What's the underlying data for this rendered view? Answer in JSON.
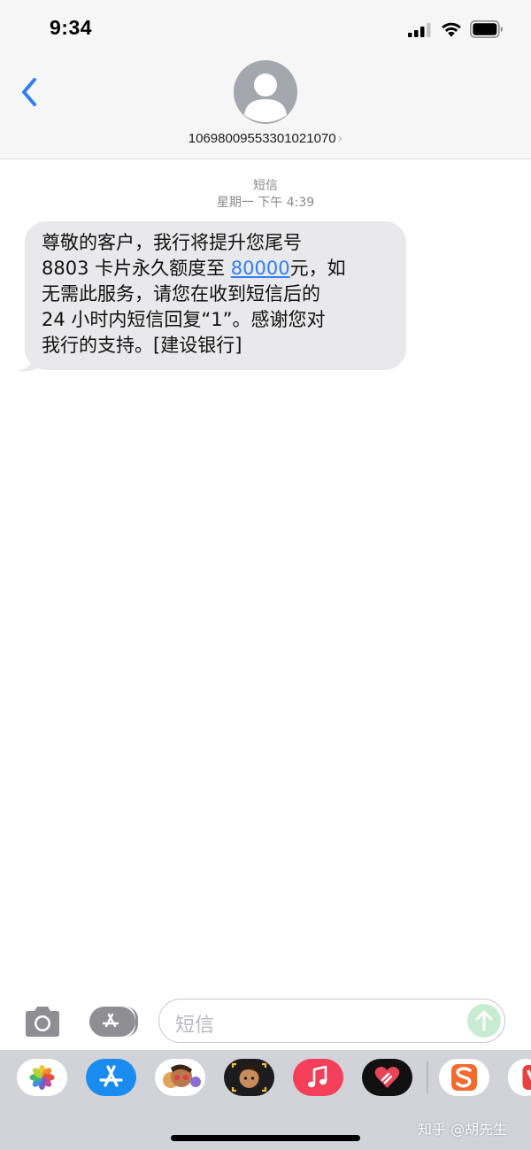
{
  "status_bar": {
    "time": "9:34"
  },
  "header": {
    "contact_number": "10698009553301021070",
    "contact_chevron": "›"
  },
  "conversation": {
    "service_label": "短信",
    "timestamp": "星期一 下午 4:39",
    "message": {
      "line1": "尊敬的客户，我行将提升您尾号",
      "line2_prefix": "8803 卡片永久额度至 ",
      "line2_link": "80000",
      "line2_suffix": "元，如",
      "line3": "无需此服务，请您在收到短信后的",
      "line4": "24 小时内短信回复“1”。感谢您对",
      "line5": "我行的支持。[建设银行]"
    }
  },
  "input_bar": {
    "placeholder": "短信"
  },
  "app_drawer": {
    "apps": [
      {
        "name": "photos-app-icon"
      },
      {
        "name": "app-store-icon"
      },
      {
        "name": "memoji-stickers-icon"
      },
      {
        "name": "memoji-camera-icon"
      },
      {
        "name": "music-app-icon"
      },
      {
        "name": "digital-touch-icon"
      },
      {
        "name": "sogou-input-icon"
      },
      {
        "name": "partial-app-icon"
      }
    ]
  },
  "watermark": {
    "text": "知乎 @胡先生"
  },
  "colors": {
    "link": "#2f7ef5",
    "back_chevron": "#2f7ef5",
    "bubble": "#e9e9eb",
    "header_bg": "#f6f6f6",
    "drawer_bg": "#d1d3d9"
  }
}
